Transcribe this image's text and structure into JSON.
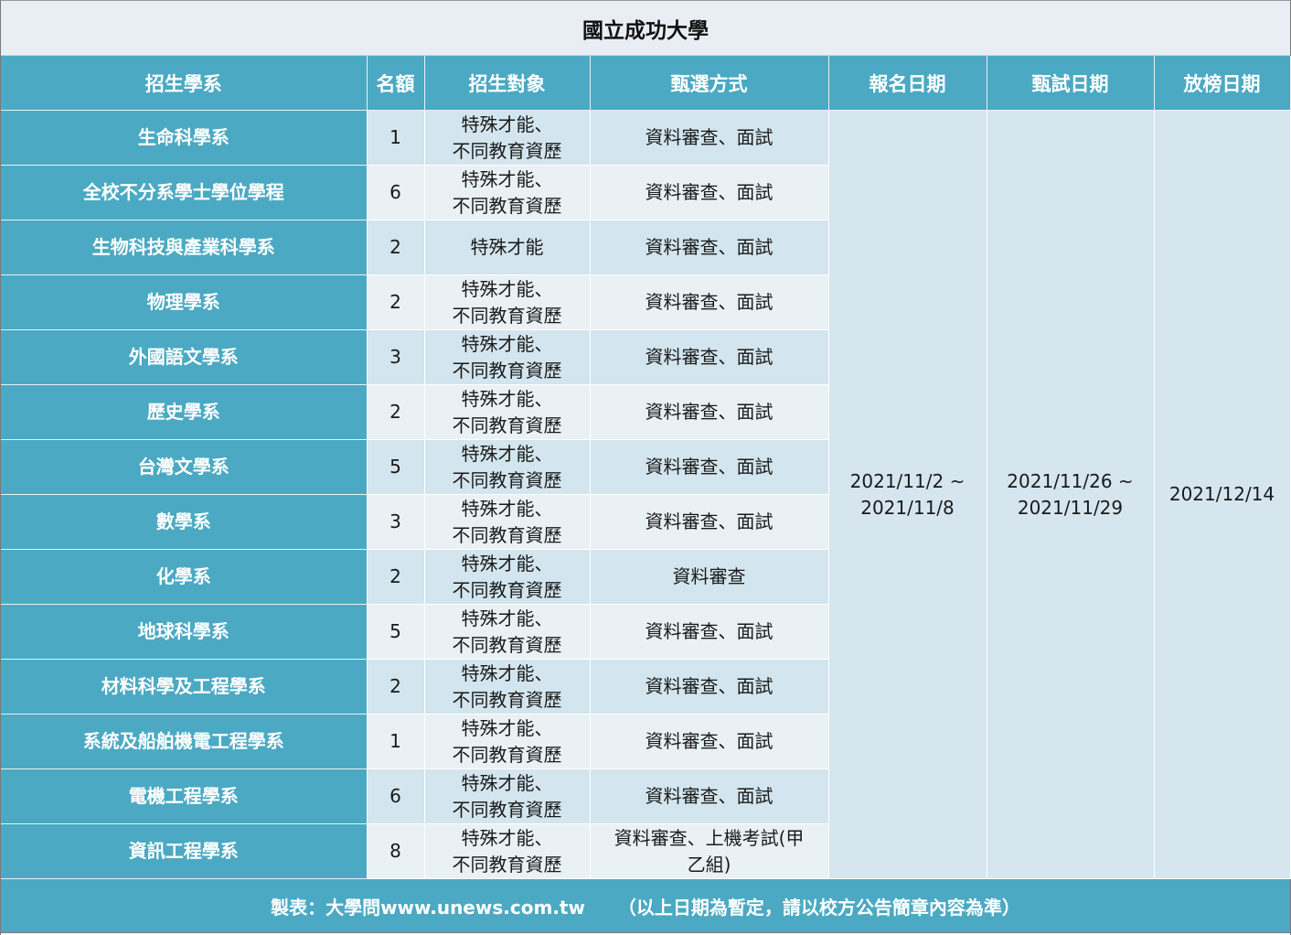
{
  "title": "國立成功大學",
  "headers": {
    "department": "招生學系",
    "quota": "名額",
    "target": "招生對象",
    "method": "甄選方式",
    "register_date": "報名日期",
    "exam_date": "甄試日期",
    "release_date": "放榜日期"
  },
  "rows": [
    {
      "department": "生命科學系",
      "quota": "1",
      "target_line1": "特殊才能、",
      "target_line2": "不同教育資歷",
      "method_line1": "資料審查、面試",
      "method_line2": ""
    },
    {
      "department": "全校不分系學士學位學程",
      "quota": "6",
      "target_line1": "特殊才能、",
      "target_line2": "不同教育資歷",
      "method_line1": "資料審查、面試",
      "method_line2": ""
    },
    {
      "department": "生物科技與產業科學系",
      "quota": "2",
      "target_line1": "特殊才能",
      "target_line2": "",
      "method_line1": "資料審查、面試",
      "method_line2": ""
    },
    {
      "department": "物理學系",
      "quota": "2",
      "target_line1": "特殊才能、",
      "target_line2": "不同教育資歷",
      "method_line1": "資料審查、面試",
      "method_line2": ""
    },
    {
      "department": "外國語文學系",
      "quota": "3",
      "target_line1": "特殊才能、",
      "target_line2": "不同教育資歷",
      "method_line1": "資料審查、面試",
      "method_line2": ""
    },
    {
      "department": "歷史學系",
      "quota": "2",
      "target_line1": "特殊才能、",
      "target_line2": "不同教育資歷",
      "method_line1": "資料審查、面試",
      "method_line2": ""
    },
    {
      "department": "台灣文學系",
      "quota": "5",
      "target_line1": "特殊才能、",
      "target_line2": "不同教育資歷",
      "method_line1": "資料審查、面試",
      "method_line2": ""
    },
    {
      "department": "數學系",
      "quota": "3",
      "target_line1": "特殊才能、",
      "target_line2": "不同教育資歷",
      "method_line1": "資料審查、面試",
      "method_line2": ""
    },
    {
      "department": "化學系",
      "quota": "2",
      "target_line1": "特殊才能、",
      "target_line2": "不同教育資歷",
      "method_line1": "資料審查",
      "method_line2": ""
    },
    {
      "department": "地球科學系",
      "quota": "5",
      "target_line1": "特殊才能、",
      "target_line2": "不同教育資歷",
      "method_line1": "資料審查、面試",
      "method_line2": ""
    },
    {
      "department": "材料科學及工程學系",
      "quota": "2",
      "target_line1": "特殊才能、",
      "target_line2": "不同教育資歷",
      "method_line1": "資料審查、面試",
      "method_line2": ""
    },
    {
      "department": "系統及船舶機電工程學系",
      "quota": "1",
      "target_line1": "特殊才能、",
      "target_line2": "不同教育資歷",
      "method_line1": "資料審查、面試",
      "method_line2": ""
    },
    {
      "department": "電機工程學系",
      "quota": "6",
      "target_line1": "特殊才能、",
      "target_line2": "不同教育資歷",
      "method_line1": "資料審查、面試",
      "method_line2": ""
    },
    {
      "department": "資訊工程學系",
      "quota": "8",
      "target_line1": "特殊才能、",
      "target_line2": "不同教育資歷",
      "method_line1": "資料審查、上機考試(甲",
      "method_line2": "乙組)"
    }
  ],
  "dates": {
    "register_line1": "2021/11/2 ~",
    "register_line2": "2021/11/8",
    "exam_line1": "2021/11/26 ~",
    "exam_line2": "2021/11/29",
    "release": "2021/12/14"
  },
  "footer": {
    "credit": "製表：大學問www.unews.com.tw",
    "note": "（以上日期為暫定，請以校方公告簡章內容為準）"
  },
  "colors": {
    "header_bg": "#4ba9c3",
    "row_odd": "#d3e5ee",
    "row_even": "#e9f1f5",
    "title_bg": "#e9eef5"
  }
}
